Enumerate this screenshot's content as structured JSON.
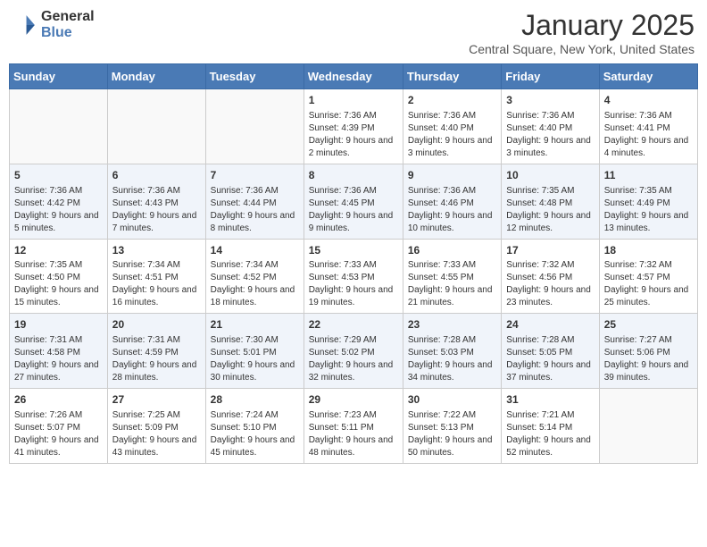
{
  "header": {
    "logo_general": "General",
    "logo_blue": "Blue",
    "month_title": "January 2025",
    "location": "Central Square, New York, United States"
  },
  "days_of_week": [
    "Sunday",
    "Monday",
    "Tuesday",
    "Wednesday",
    "Thursday",
    "Friday",
    "Saturday"
  ],
  "weeks": [
    [
      {
        "day": "",
        "info": ""
      },
      {
        "day": "",
        "info": ""
      },
      {
        "day": "",
        "info": ""
      },
      {
        "day": "1",
        "info": "Sunrise: 7:36 AM\nSunset: 4:39 PM\nDaylight: 9 hours and 2 minutes."
      },
      {
        "day": "2",
        "info": "Sunrise: 7:36 AM\nSunset: 4:40 PM\nDaylight: 9 hours and 3 minutes."
      },
      {
        "day": "3",
        "info": "Sunrise: 7:36 AM\nSunset: 4:40 PM\nDaylight: 9 hours and 3 minutes."
      },
      {
        "day": "4",
        "info": "Sunrise: 7:36 AM\nSunset: 4:41 PM\nDaylight: 9 hours and 4 minutes."
      }
    ],
    [
      {
        "day": "5",
        "info": "Sunrise: 7:36 AM\nSunset: 4:42 PM\nDaylight: 9 hours and 5 minutes."
      },
      {
        "day": "6",
        "info": "Sunrise: 7:36 AM\nSunset: 4:43 PM\nDaylight: 9 hours and 7 minutes."
      },
      {
        "day": "7",
        "info": "Sunrise: 7:36 AM\nSunset: 4:44 PM\nDaylight: 9 hours and 8 minutes."
      },
      {
        "day": "8",
        "info": "Sunrise: 7:36 AM\nSunset: 4:45 PM\nDaylight: 9 hours and 9 minutes."
      },
      {
        "day": "9",
        "info": "Sunrise: 7:36 AM\nSunset: 4:46 PM\nDaylight: 9 hours and 10 minutes."
      },
      {
        "day": "10",
        "info": "Sunrise: 7:35 AM\nSunset: 4:48 PM\nDaylight: 9 hours and 12 minutes."
      },
      {
        "day": "11",
        "info": "Sunrise: 7:35 AM\nSunset: 4:49 PM\nDaylight: 9 hours and 13 minutes."
      }
    ],
    [
      {
        "day": "12",
        "info": "Sunrise: 7:35 AM\nSunset: 4:50 PM\nDaylight: 9 hours and 15 minutes."
      },
      {
        "day": "13",
        "info": "Sunrise: 7:34 AM\nSunset: 4:51 PM\nDaylight: 9 hours and 16 minutes."
      },
      {
        "day": "14",
        "info": "Sunrise: 7:34 AM\nSunset: 4:52 PM\nDaylight: 9 hours and 18 minutes."
      },
      {
        "day": "15",
        "info": "Sunrise: 7:33 AM\nSunset: 4:53 PM\nDaylight: 9 hours and 19 minutes."
      },
      {
        "day": "16",
        "info": "Sunrise: 7:33 AM\nSunset: 4:55 PM\nDaylight: 9 hours and 21 minutes."
      },
      {
        "day": "17",
        "info": "Sunrise: 7:32 AM\nSunset: 4:56 PM\nDaylight: 9 hours and 23 minutes."
      },
      {
        "day": "18",
        "info": "Sunrise: 7:32 AM\nSunset: 4:57 PM\nDaylight: 9 hours and 25 minutes."
      }
    ],
    [
      {
        "day": "19",
        "info": "Sunrise: 7:31 AM\nSunset: 4:58 PM\nDaylight: 9 hours and 27 minutes."
      },
      {
        "day": "20",
        "info": "Sunrise: 7:31 AM\nSunset: 4:59 PM\nDaylight: 9 hours and 28 minutes."
      },
      {
        "day": "21",
        "info": "Sunrise: 7:30 AM\nSunset: 5:01 PM\nDaylight: 9 hours and 30 minutes."
      },
      {
        "day": "22",
        "info": "Sunrise: 7:29 AM\nSunset: 5:02 PM\nDaylight: 9 hours and 32 minutes."
      },
      {
        "day": "23",
        "info": "Sunrise: 7:28 AM\nSunset: 5:03 PM\nDaylight: 9 hours and 34 minutes."
      },
      {
        "day": "24",
        "info": "Sunrise: 7:28 AM\nSunset: 5:05 PM\nDaylight: 9 hours and 37 minutes."
      },
      {
        "day": "25",
        "info": "Sunrise: 7:27 AM\nSunset: 5:06 PM\nDaylight: 9 hours and 39 minutes."
      }
    ],
    [
      {
        "day": "26",
        "info": "Sunrise: 7:26 AM\nSunset: 5:07 PM\nDaylight: 9 hours and 41 minutes."
      },
      {
        "day": "27",
        "info": "Sunrise: 7:25 AM\nSunset: 5:09 PM\nDaylight: 9 hours and 43 minutes."
      },
      {
        "day": "28",
        "info": "Sunrise: 7:24 AM\nSunset: 5:10 PM\nDaylight: 9 hours and 45 minutes."
      },
      {
        "day": "29",
        "info": "Sunrise: 7:23 AM\nSunset: 5:11 PM\nDaylight: 9 hours and 48 minutes."
      },
      {
        "day": "30",
        "info": "Sunrise: 7:22 AM\nSunset: 5:13 PM\nDaylight: 9 hours and 50 minutes."
      },
      {
        "day": "31",
        "info": "Sunrise: 7:21 AM\nSunset: 5:14 PM\nDaylight: 9 hours and 52 minutes."
      },
      {
        "day": "",
        "info": ""
      }
    ]
  ]
}
